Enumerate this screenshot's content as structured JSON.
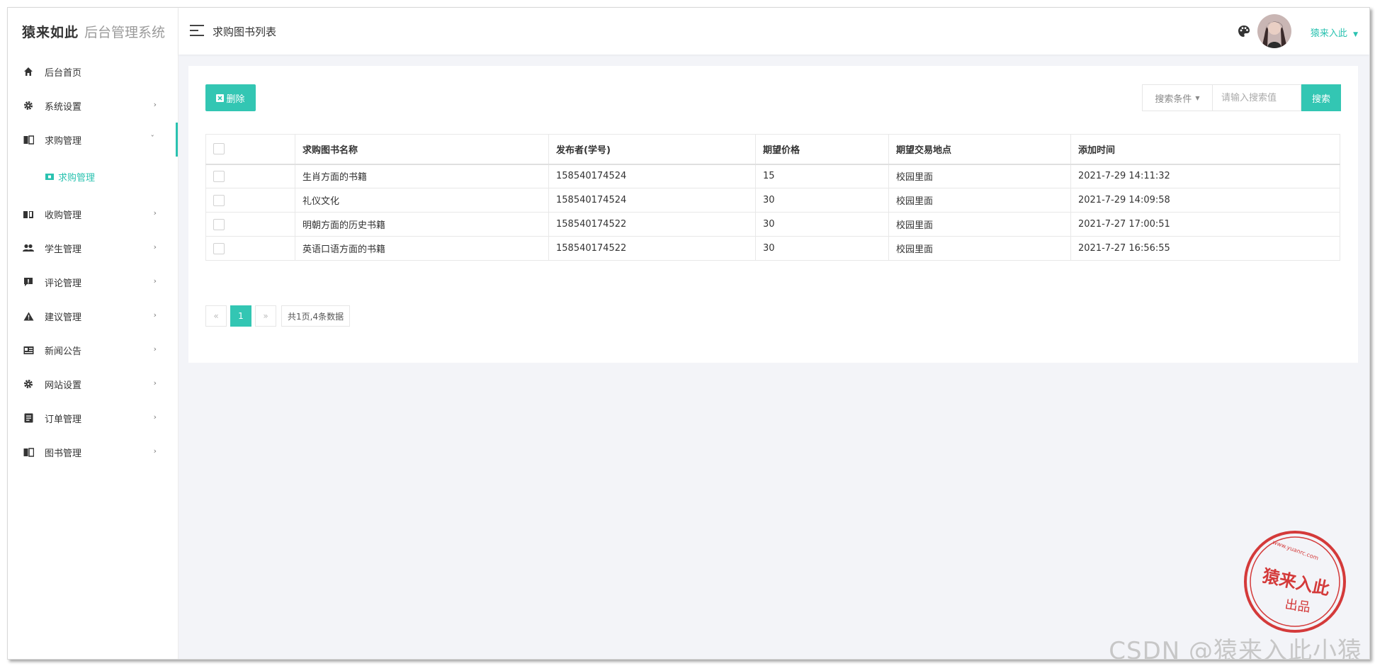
{
  "app": {
    "brand": "猿来如此",
    "system_name": "后台管理系统",
    "accent_color": "#2ac2b0"
  },
  "header": {
    "page_title": "求购图书列表",
    "user_name": "猿来入此",
    "icons": [
      "menu-icon",
      "palette-icon",
      "avatar",
      "caret-down-icon"
    ]
  },
  "sidebar": {
    "items": [
      {
        "label": "后台首页",
        "icon": "home-icon"
      },
      {
        "label": "系统设置",
        "icon": "gear-icon"
      },
      {
        "label": "求购管理",
        "icon": "book-icon"
      },
      {
        "label": "收购管理",
        "icon": "open-book-icon"
      },
      {
        "label": "学生管理",
        "icon": "people-icon"
      },
      {
        "label": "评论管理",
        "icon": "comment-icon"
      },
      {
        "label": "建议管理",
        "icon": "warning-icon"
      },
      {
        "label": "新闻公告",
        "icon": "news-icon"
      },
      {
        "label": "网站设置",
        "icon": "gear-icon"
      },
      {
        "label": "订单管理",
        "icon": "document-icon"
      },
      {
        "label": "图书管理",
        "icon": "book-icon"
      }
    ],
    "submenu": {
      "label": "求购管理",
      "icon": "ticket-icon"
    }
  },
  "toolbar": {
    "delete_label": "删除",
    "search_select_label": "搜索条件",
    "search_placeholder": "请输入搜索值",
    "search_button": "搜索"
  },
  "table": {
    "columns": [
      "求购图书名称",
      "发布者(学号)",
      "期望价格",
      "期望交易地点",
      "添加时间"
    ],
    "rows": [
      {
        "name": "生肖方面的书籍",
        "publisher": "158540174524",
        "price": "15",
        "location": "校园里面",
        "time": "2021-7-29 14:11:32"
      },
      {
        "name": "礼仪文化",
        "publisher": "158540174524",
        "price": "30",
        "location": "校园里面",
        "time": "2021-7-29 14:09:58"
      },
      {
        "name": "明朝方面的历史书籍",
        "publisher": "158540174522",
        "price": "30",
        "location": "校园里面",
        "time": "2021-7-27 17:00:51"
      },
      {
        "name": "英语口语方面的书籍",
        "publisher": "158540174522",
        "price": "30",
        "location": "校园里面",
        "time": "2021-7-27 16:56:55"
      }
    ]
  },
  "pagination": {
    "prev": "«",
    "current": "1",
    "next": "»",
    "summary": "共1页,4条数据"
  },
  "watermark": {
    "stamp_main": "猿来入此",
    "stamp_sub": "出品",
    "stamp_url": "www.yuanrc.com",
    "csdn": "CSDN @猿来入此小猿"
  }
}
